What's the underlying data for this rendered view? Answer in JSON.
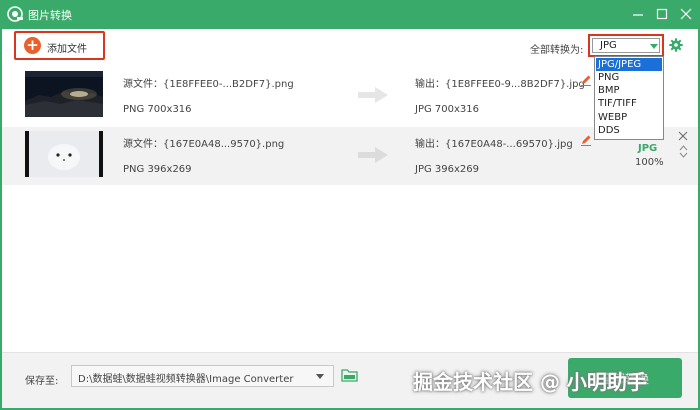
{
  "window": {
    "title": "图片转换"
  },
  "toolbar": {
    "add_file_label": "添加文件",
    "convert_all_label": "全部转换为:",
    "selected_format": "JPG"
  },
  "dropdown": {
    "options": [
      "JPG/JPEG",
      "PNG",
      "BMP",
      "TIF/TIFF",
      "WEBP",
      "DDS"
    ],
    "highlighted": "JPG/JPEG"
  },
  "files": [
    {
      "source_name": "源文件：{1E8FFEE0-...B2DF7}.png",
      "source_info": "PNG   700x316",
      "output_name": "输出：{1E8FFEE0-9...8B2DF7}.jpg",
      "output_info": "JPG   700x316"
    },
    {
      "source_name": "源文件：{167E0A48...9570}.png",
      "source_info": "PNG   396x269",
      "output_name": "输出：{167E0A48-...69570}.jpg",
      "output_info": "JPG   396x269",
      "status_format": "JPG",
      "status_progress": "100%"
    }
  ],
  "bottom": {
    "save_label": "保存至:",
    "save_path": "D:\\数据蛙\\数据蛙视频转换器\\Image Converter",
    "convert_all_button": "全部转换"
  },
  "watermark": "掘金技术社区 @ 小明助手",
  "colors": {
    "brand_green": "#3aaa6a",
    "highlight_red": "#d9361e",
    "add_icon_orange": "#e8612c",
    "dropdown_selection": "#1a6fd8"
  }
}
